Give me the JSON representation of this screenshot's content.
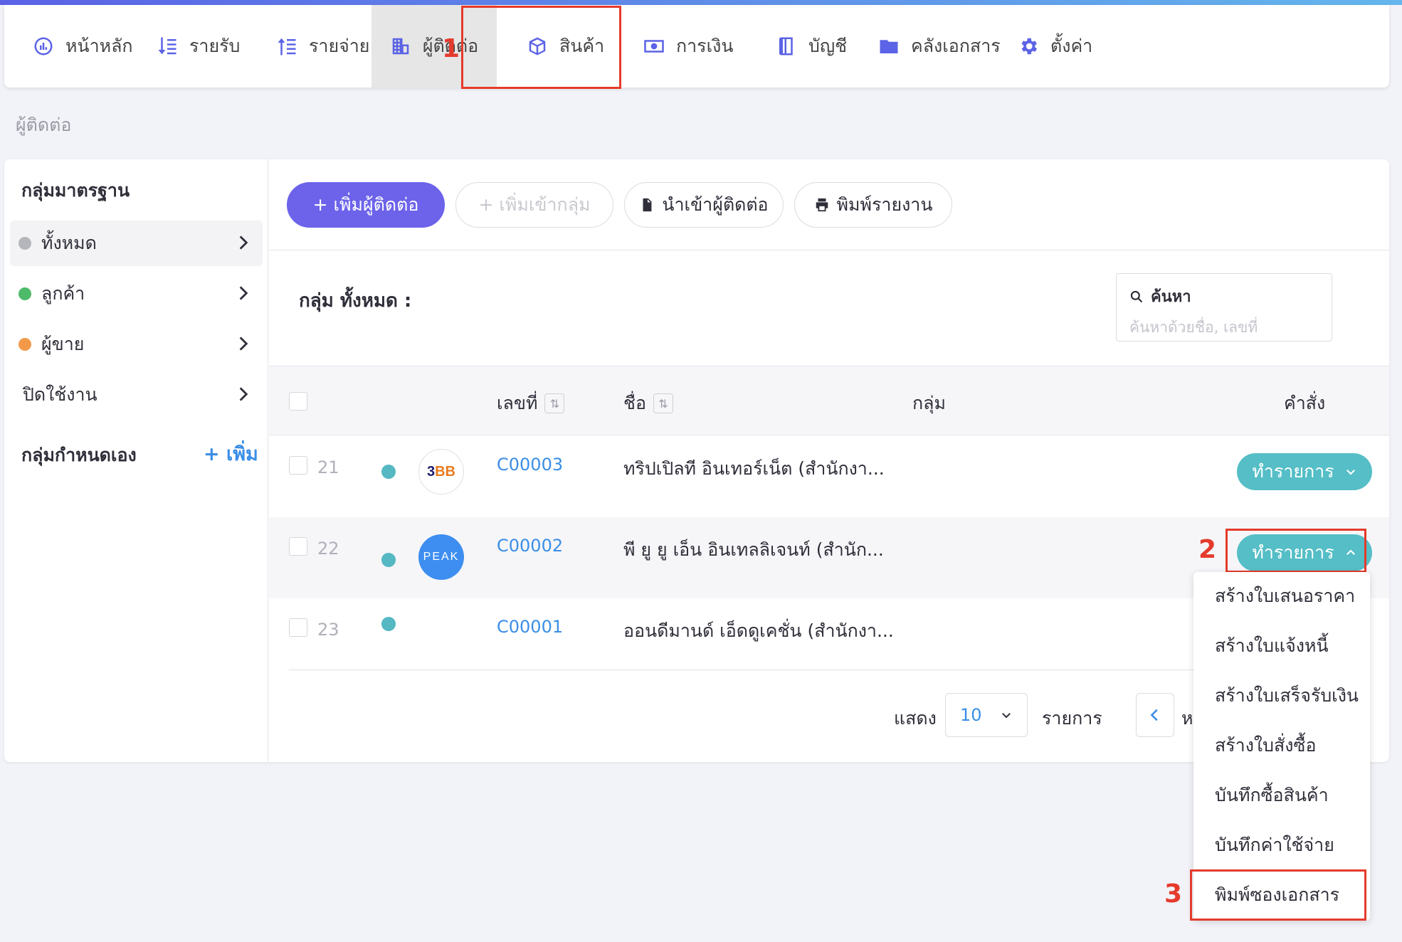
{
  "nav": {
    "items": [
      {
        "label": "หน้าหลัก",
        "icon": "dashboard-icon"
      },
      {
        "label": "รายรับ",
        "icon": "income-icon"
      },
      {
        "label": "รายจ่าย",
        "icon": "expense-icon"
      },
      {
        "label": "ผู้ติดต่อ",
        "icon": "contacts-icon"
      },
      {
        "label": "สินค้า",
        "icon": "box-icon"
      },
      {
        "label": "การเงิน",
        "icon": "money-icon"
      },
      {
        "label": "บัญชี",
        "icon": "book-icon"
      },
      {
        "label": "คลังเอกสาร",
        "icon": "folder-icon"
      },
      {
        "label": "ตั้งค่า",
        "icon": "gear-icon"
      }
    ],
    "active": "ผู้ติดต่อ"
  },
  "annotations": {
    "step1": "1",
    "step2": "2",
    "step3": "3"
  },
  "breadcrumb": "ผู้ติดต่อ",
  "sidebar": {
    "standard_title": "กลุ่มมาตรฐาน",
    "items": [
      {
        "label": "ทั้งหมด",
        "dot": "#b5b5bc"
      },
      {
        "label": "ลูกค้า",
        "dot": "#4dba6a"
      },
      {
        "label": "ผู้ขาย",
        "dot": "#f29a4a"
      },
      {
        "label": "ปิดใช้งาน",
        "dot": ""
      }
    ],
    "custom_title": "กลุ่มกำหนดเอง",
    "add_label": "+ เพิ่ม"
  },
  "toolbar": {
    "add_contact": "+ เพิ่มผู้ติดต่อ",
    "add_to_group": "+ เพิ่มเข้ากลุ่ม",
    "import_contacts": "นำเข้าผู้ติดต่อ",
    "print_report": "พิมพ์รายงาน"
  },
  "group_label": "กลุ่ม ทั้งหมด :",
  "search": {
    "title": "ค้นหา",
    "placeholder": "ค้นหาด้วยชื่อ, เลขที่"
  },
  "table": {
    "headers": {
      "number": "เลขที่",
      "name": "ชื่อ",
      "group": "กลุ่ม",
      "command": "คำสั่ง"
    },
    "rows": [
      {
        "num": "21",
        "code": "C00003",
        "name": "ทริปเปิลที อินเทอร์เน็ต (สำนักงา...",
        "avatar": "3BB",
        "action": "ทำรายการ"
      },
      {
        "num": "22",
        "code": "C00002",
        "name": "พี ยู ยู เอ็น อินเทลลิเจนท์ (สำนัก...",
        "avatar": "PEAK",
        "action": "ทำรายการ"
      },
      {
        "num": "23",
        "code": "C00001",
        "name": "ออนดีมานด์ เอ็ดดูเคชั่น (สำนักงา...",
        "avatar": "",
        "action": ""
      }
    ]
  },
  "pagination": {
    "show": "แสดง",
    "page_size": "10",
    "items": "รายการ",
    "next_partial": "ห"
  },
  "dropdown": {
    "items": [
      "สร้างใบเสนอราคา",
      "สร้างใบแจ้งหนี้",
      "สร้างใบเสร็จรับเงิน",
      "สร้างใบสั่งซื้อ",
      "บันทึกซื้อสินค้า",
      "บันทึกค่าใช้จ่าย",
      "พิมพ์ซองเอกสาร"
    ]
  },
  "colors": {
    "primary": "#6c63ea",
    "action": "#55bec6",
    "link": "#3a8ee6",
    "annotation": "#e53b2c"
  }
}
